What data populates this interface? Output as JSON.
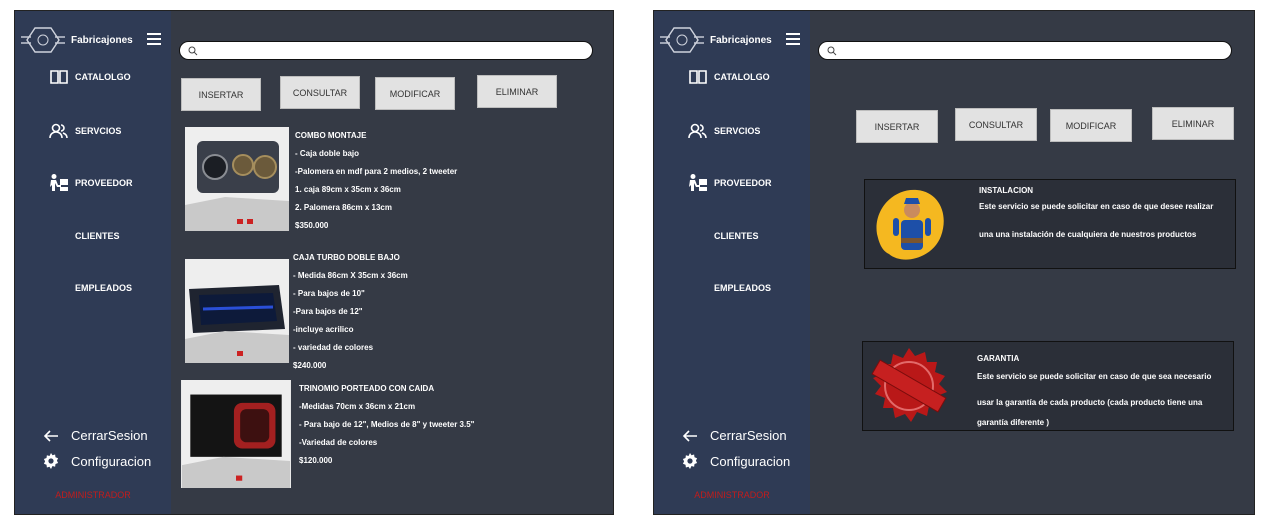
{
  "brand": {
    "name": "Fabricajones"
  },
  "nav": [
    {
      "label": "CATALOLGO",
      "icon": "book-icon"
    },
    {
      "label": "SERVCIOS",
      "icon": "users-icon"
    },
    {
      "label": "PROVEEDOR",
      "icon": "supplier-icon"
    },
    {
      "label": "CLIENTES"
    },
    {
      "label": "EMPLEADOS"
    }
  ],
  "logout": {
    "label": "CerrarSesion",
    "icon": "arrow-left-icon"
  },
  "settings": {
    "label": "Configuracion",
    "icon": "gear-icon"
  },
  "role": "ADMINISTRADOR",
  "search": {
    "placeholder": ""
  },
  "buttons": {
    "insert": "INSERTAR",
    "query": "CONSULTAR",
    "modify": "MODIFICAR",
    "delete": "ELIMINAR"
  },
  "catalog": [
    {
      "lines": [
        "COMBO MONTAJE",
        "- Caja doble bajo",
        "-Palomera en mdf para 2 medios, 2 tweeter",
        "1. caja 89cm x 35cm x 36cm",
        "2. Palomera 86cm x 13cm",
        "$350.000"
      ]
    },
    {
      "lines": [
        "CAJA TURBO DOBLE BAJO",
        "- Medida 86cm X 35cm x 36cm",
        "- Para bajos de 10\"",
        "-Para bajos de 12\"",
        "-incluye acrilico",
        "- variedad de colores",
        "$240.000"
      ]
    },
    {
      "lines": [
        "TRINOMIO PORTEADO CON CAIDA",
        "-Medidas 70cm x 36cm x 21cm",
        "- Para bajo de 12\", Medios de 8\" y tweeter 3.5\"",
        "-Variedad de colores",
        "$120.000"
      ]
    }
  ],
  "services": [
    {
      "title": "INSTALACION",
      "lines": [
        "Este servicio se puede solicitar en caso de que desee realizar",
        "una una instalación de cualquiera de nuestros productos"
      ]
    },
    {
      "title": "GARANTIA",
      "lines": [
        "Este servicio se puede solicitar en caso de que sea necesario",
        "usar la garantía de cada producto  (cada producto tiene una",
        "garantía diferente )"
      ]
    }
  ],
  "colors": {
    "sidebar": "#2f3b55",
    "main": "#353a45",
    "role": "#c21c1c"
  }
}
